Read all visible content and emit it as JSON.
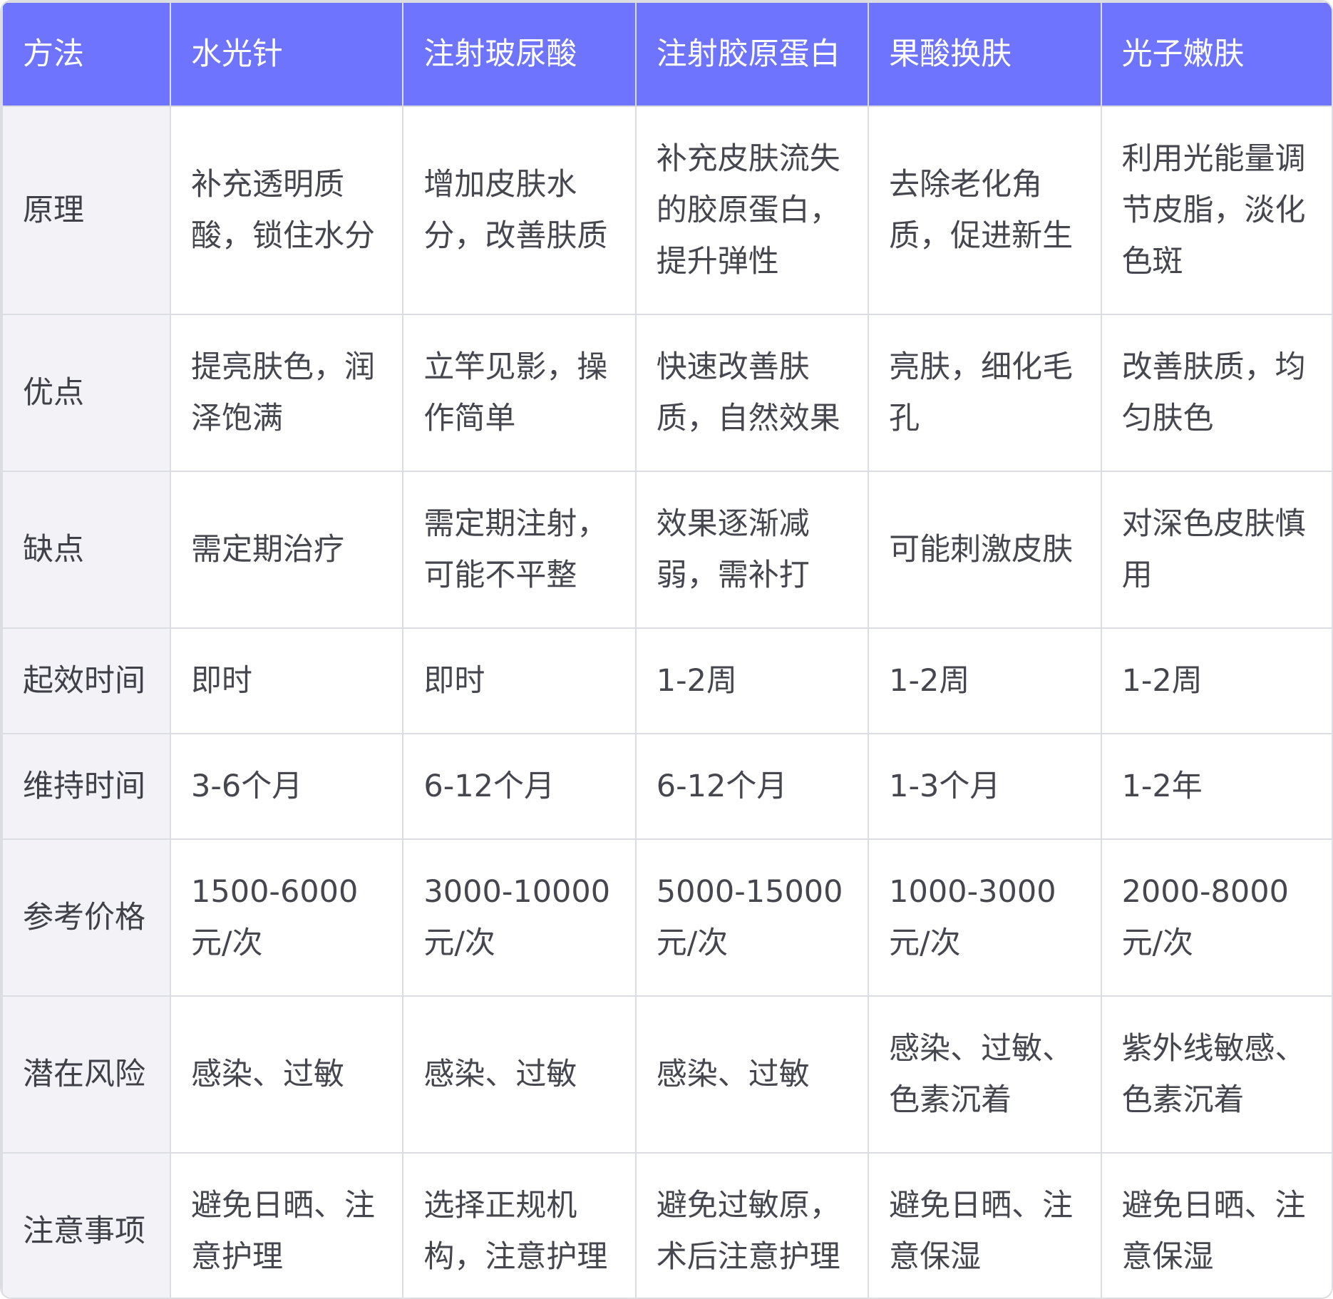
{
  "table": {
    "headers": [
      "方法",
      "水光针",
      "注射玻尿酸",
      "注射胶原蛋白",
      "果酸换肤",
      "光子嫩肤"
    ],
    "rows": [
      {
        "label": "原理",
        "cells": [
          "补充透明质酸，锁住水分",
          "增加皮肤水分，改善肤质",
          "补充皮肤流失的胶原蛋白，提升弹性",
          "去除老化角质，促进新生",
          "利用光能量调节皮脂，淡化色斑"
        ]
      },
      {
        "label": "优点",
        "cells": [
          "提亮肤色，润泽饱满",
          "立竿见影，操作简单",
          "快速改善肤质，自然效果",
          "亮肤，细化毛孔",
          "改善肤质，均匀肤色"
        ]
      },
      {
        "label": "缺点",
        "cells": [
          "需定期治疗",
          "需定期注射，可能不平整",
          "效果逐渐减弱，需补打",
          "可能刺激皮肤",
          "对深色皮肤慎用"
        ]
      },
      {
        "label": "起效时间",
        "cells": [
          "即时",
          "即时",
          "1-2周",
          "1-2周",
          "1-2周"
        ]
      },
      {
        "label": "维持时间",
        "cells": [
          "3-6个月",
          "6-12个月",
          "6-12个月",
          "1-3个月",
          "1-2年"
        ]
      },
      {
        "label": "参考价格",
        "cells": [
          "1500-6000元/次",
          "3000-10000元/次",
          "5000-15000元/次",
          "1000-3000元/次",
          "2000-8000元/次"
        ]
      },
      {
        "label": "潜在风险",
        "cells": [
          "感染、过敏",
          "感染、过敏",
          "感染、过敏",
          "感染、过敏、色素沉着",
          "紫外线敏感、色素沉着"
        ]
      },
      {
        "label": "注意事项",
        "cells": [
          "避免日晒、注意护理",
          "选择正规机构，注意护理",
          "避免过敏原，术后注意护理",
          "避免日晒、注意保湿",
          "避免日晒、注意保湿"
        ]
      }
    ]
  }
}
